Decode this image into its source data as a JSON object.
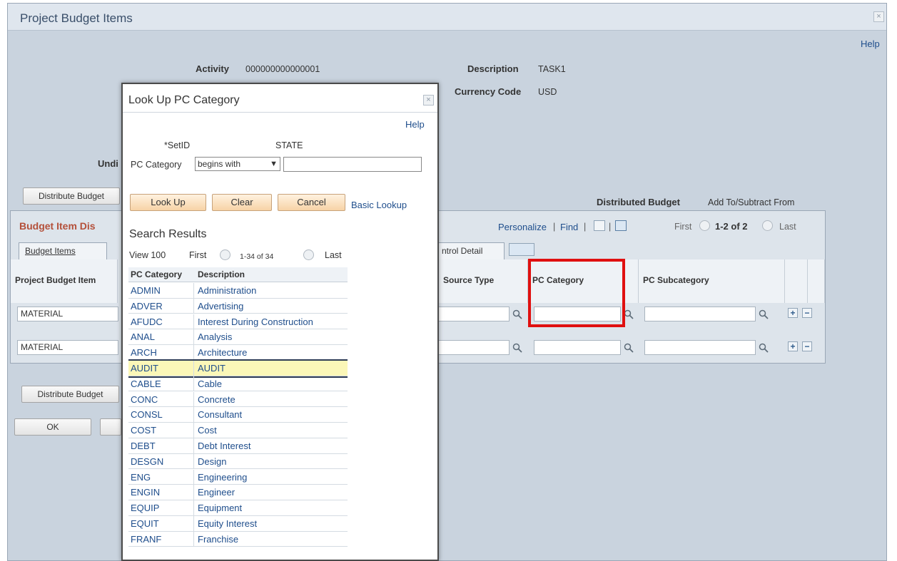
{
  "page": {
    "title": "Project Budget Items",
    "help": "Help",
    "activity_label": "Activity",
    "activity_value": "000000000000001",
    "description_label": "Description",
    "description_value": "TASK1",
    "currency_label": "Currency Code",
    "currency_value": "USD",
    "undist_label": "Undi",
    "distribute_btn": "Distribute Budget",
    "distributed_budget_label": "Distributed Budget",
    "distributed_budget_value": "Add To/Subtract From",
    "ok_btn": "OK"
  },
  "grid": {
    "title": "Budget Item Dis",
    "personalize": "Personalize",
    "find": "Find",
    "sep": "|",
    "first": "First",
    "range": "1-2 of 2",
    "last": "Last",
    "tabs": [
      "Budget Items",
      "ntrol Detail"
    ],
    "columns": [
      "Project Budget Item",
      "Source Type",
      "PC Category",
      "PC Subcategory"
    ],
    "rows": [
      {
        "budget_item": "MATERIAL"
      },
      {
        "budget_item": "MATERIAL"
      }
    ]
  },
  "modal": {
    "title": "Look Up PC Category",
    "help": "Help",
    "setid_label": "*SetID",
    "setid_value": "STATE",
    "pccat_label": "PC Category",
    "operator": "begins with",
    "lookup_btn": "Look Up",
    "clear_btn": "Clear",
    "cancel_btn": "Cancel",
    "basic_lookup": "Basic Lookup",
    "search_results": "Search Results",
    "view100": "View 100",
    "first": "First",
    "range": "1-34 of 34",
    "last": "Last",
    "col_code": "PC Category",
    "col_desc": "Description",
    "results": [
      {
        "code": "ADMIN",
        "desc": "Administration"
      },
      {
        "code": "ADVER",
        "desc": "Advertising"
      },
      {
        "code": "AFUDC",
        "desc": "Interest During Construction"
      },
      {
        "code": "ANAL",
        "desc": "Analysis"
      },
      {
        "code": "ARCH",
        "desc": "Architecture"
      },
      {
        "code": "AUDIT",
        "desc": "AUDIT"
      },
      {
        "code": "CABLE",
        "desc": "Cable"
      },
      {
        "code": "CONC",
        "desc": "Concrete"
      },
      {
        "code": "CONSL",
        "desc": "Consultant"
      },
      {
        "code": "COST",
        "desc": "Cost"
      },
      {
        "code": "DEBT",
        "desc": "Debt Interest"
      },
      {
        "code": "DESGN",
        "desc": "Design"
      },
      {
        "code": "ENG",
        "desc": "Engineering"
      },
      {
        "code": "ENGIN",
        "desc": "Engineer"
      },
      {
        "code": "EQUIP",
        "desc": "Equipment"
      },
      {
        "code": "EQUIT",
        "desc": "Equity Interest"
      },
      {
        "code": "FRANF",
        "desc": "Franchise"
      }
    ]
  },
  "colors": {
    "highlight_row": "#fbf7b8",
    "callout": "#e01010",
    "link": "#1f4e8c"
  }
}
